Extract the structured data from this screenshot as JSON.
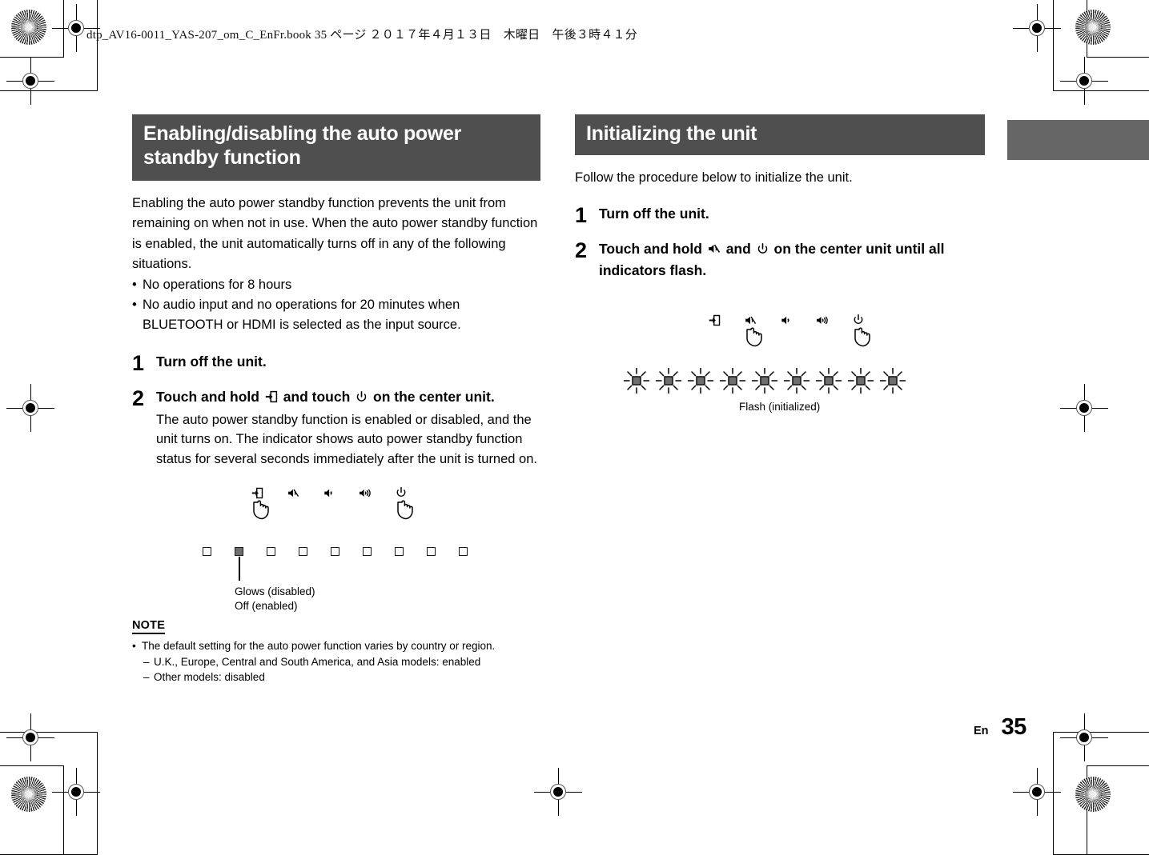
{
  "page": {
    "slug_line": "dtp_AV16-0011_YAS-207_om_C_EnFr.book   35 ページ   ２０１７年４月１３日　木曜日　午後３時４１分",
    "footer_lang": "En",
    "footer_page": "35",
    "accent_gray": "#4f4f4f",
    "tab_gray": "#666666",
    "led_on_color": "#6e6e6e"
  },
  "left_column": {
    "section_title": "Enabling/disabling the auto power standby function",
    "intro": "Enabling the auto power standby function prevents the unit from remaining on when not in use. When the auto power standby function is enabled, the unit automatically turns off in any of the following situations.",
    "bullets": [
      "No operations for 8 hours",
      "No audio input and no operations for 20 minutes when BLUETOOTH or HDMI is selected as the input source."
    ],
    "steps": [
      {
        "number": "1",
        "headline_parts": [
          "Turn off the unit."
        ],
        "detail": ""
      },
      {
        "number": "2",
        "headline_parts": [
          "Touch and hold ",
          "input-icon",
          " and touch ",
          "power-icon",
          " on the center unit."
        ],
        "detail": "The auto power standby function is enabled or disabled, and the unit turns on. The indicator shows auto power standby function status for several seconds immediately after the unit is turned on."
      }
    ],
    "diagram": {
      "control_icons": [
        "input-icon",
        "mute-icon",
        "volume-down-icon",
        "volume-up-icon",
        "power-icon"
      ],
      "hand_on": [
        "input-icon",
        "power-icon"
      ],
      "indicator_count": 9,
      "indicator_states": [
        "off",
        "on",
        "off",
        "off",
        "off",
        "off",
        "off",
        "off",
        "off"
      ],
      "callout_index": 1,
      "caption_lines": [
        "Glows (disabled)",
        "Off (enabled)"
      ]
    },
    "note": {
      "heading": "NOTE",
      "items": [
        {
          "text": "The default setting for the auto power function varies by country or region.",
          "sub_items": [
            "U.K., Europe, Central and South America, and Asia models: enabled",
            "Other models: disabled"
          ]
        }
      ]
    }
  },
  "right_column": {
    "section_title": "Initializing the unit",
    "intro": "Follow the procedure below to initialize the unit.",
    "steps": [
      {
        "number": "1",
        "headline_parts": [
          "Turn off the unit."
        ],
        "detail": ""
      },
      {
        "number": "2",
        "headline_parts": [
          "Touch and hold ",
          "mute-icon",
          " and ",
          "power-icon",
          " on the center unit until all indicators flash."
        ],
        "detail": ""
      }
    ],
    "diagram": {
      "control_icons": [
        "input-icon",
        "mute-icon",
        "volume-down-icon",
        "volume-up-icon",
        "power-icon"
      ],
      "hand_on": [
        "mute-icon",
        "power-icon"
      ],
      "indicator_count": 9,
      "indicator_states": [
        "flash",
        "flash",
        "flash",
        "flash",
        "flash",
        "flash",
        "flash",
        "flash",
        "flash"
      ],
      "caption_lines": [
        "Flash (initialized)"
      ]
    }
  }
}
